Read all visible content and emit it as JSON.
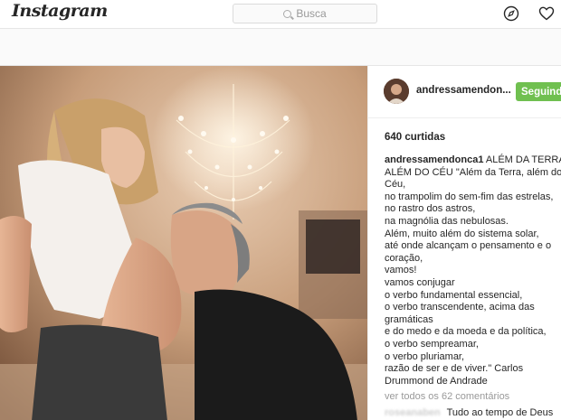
{
  "header": {
    "logo": "Instagram",
    "search_placeholder": "Busca",
    "explore_icon": "compass-icon",
    "activity_icon": "heart-icon"
  },
  "post": {
    "username": "andressamendon...",
    "follow_label": "Seguindo",
    "likes": "640 curtidas",
    "caption_user": "andressamendonca1",
    "caption_first": " ALÉM DA TERRA,",
    "caption_lines": [
      "ALÉM DO CÉU \"Além da Terra, além do",
      "Céu,",
      "no trampolim do sem-fim das estrelas,",
      "no rastro dos astros,",
      "na magnólia das nebulosas.",
      "Além, muito além do sistema solar,",
      "até onde alcançam o pensamento e o",
      "coração,",
      "vamos!",
      "vamos conjugar",
      "o verbo fundamental essencial,",
      "o verbo transcendente, acima das",
      "gramáticas",
      "e do medo e da moeda e da política,",
      "o verbo sempreamar,",
      "o verbo pluriamar,",
      "razão de ser e de viver.\" Carlos",
      "Drummond de Andrade"
    ],
    "comments_link": "ver todos os 62 comentários",
    "comment_user": "roseanaben",
    "comment_text": "Tudo ao tempo de Deus"
  },
  "colors": {
    "follow_green": "#70c050",
    "muted_text": "#999999"
  }
}
